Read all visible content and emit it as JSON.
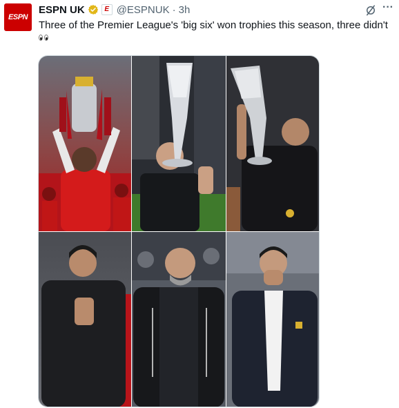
{
  "account": {
    "avatar_text": "ESPN",
    "name": "ESPN UK",
    "handle": "@ESPNUK",
    "separator": "·",
    "time": "3h",
    "affiliate_badge_text": "E"
  },
  "tweet": {
    "text": "Three of the Premier League's 'big six' won trophies this season, three didn't"
  },
  "icons": {
    "verified": "verified-gold-badge-icon",
    "grok": "grok-slash-icon",
    "more": "more-dots-icon",
    "emoji": "eyes-emoji-icon"
  },
  "colors": {
    "brand_red": "#cc0000",
    "verified_gold": "#e2b719",
    "text_primary": "#0f1419",
    "text_secondary": "#536471"
  },
  "media": {
    "photos": [
      {
        "name": "photo-premier-league-trophy"
      },
      {
        "name": "photo-europa-league-trophy"
      },
      {
        "name": "photo-conference-league-trophy"
      },
      {
        "name": "photo-arsenal-manager"
      },
      {
        "name": "photo-man-city-manager"
      },
      {
        "name": "photo-man-united-manager"
      }
    ]
  }
}
